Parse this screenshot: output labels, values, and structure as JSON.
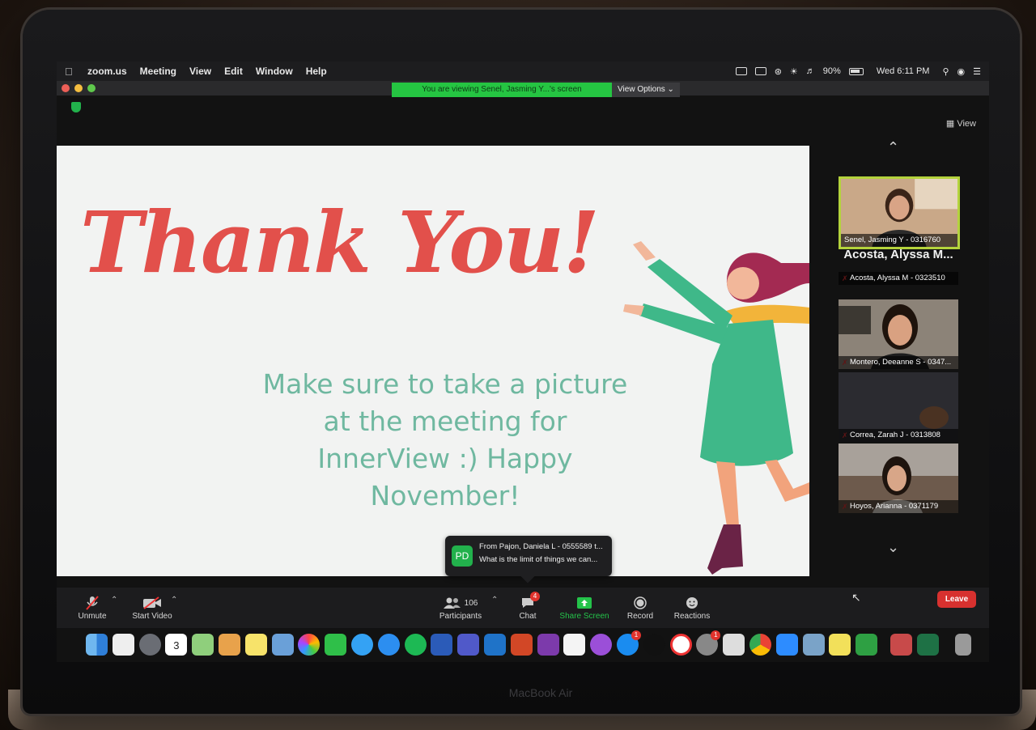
{
  "menubar": {
    "app": "zoom.us",
    "items": [
      "Meeting",
      "View",
      "Edit",
      "Window",
      "Help"
    ],
    "battery": "90%",
    "clock": "Wed 6:11 PM"
  },
  "banner": {
    "viewing": "You are viewing Senel, Jasming Y...'s screen",
    "view_options": "View Options ⌄"
  },
  "view_button": "View",
  "slide": {
    "title": "Thank You!",
    "message_lines": [
      "Make sure to take a picture",
      "at the meeting for",
      "InnerView :) Happy",
      "November!"
    ]
  },
  "participants": [
    {
      "name": "Senel, Jasming Y - 0316760",
      "active": true
    },
    {
      "big_name": "Acosta, Alyssa M...",
      "name": "Acosta, Alyssa M - 0323510"
    },
    {
      "name": "Montero, Deeanne S - 0347..."
    },
    {
      "name": "Correa, Zarah J - 0313808"
    },
    {
      "name": "Hoyos, Arianna - 0371179"
    }
  ],
  "chat_toast": {
    "initials": "PD",
    "from": "From Pajon, Daniela L - 0555589 t...",
    "message": "What is the limit of things we can..."
  },
  "toolbar": {
    "unmute": "Unmute",
    "start_video": "Start Video",
    "participants": "Participants",
    "participant_count": "106",
    "chat": "Chat",
    "chat_badge": "4",
    "share_screen": "Share Screen",
    "record": "Record",
    "reactions": "Reactions",
    "leave": "Leave"
  },
  "dock": {
    "calendar_day": "3",
    "appstore_badge": "1",
    "settings_badge": "1"
  },
  "laptop_brand": "MacBook Air",
  "colors": {
    "zoom_green": "#25c542",
    "leave_red": "#d7312f",
    "thanks_red": "#e2504b",
    "slide_text": "#6fb8a0",
    "active_border": "#b4d33c"
  }
}
